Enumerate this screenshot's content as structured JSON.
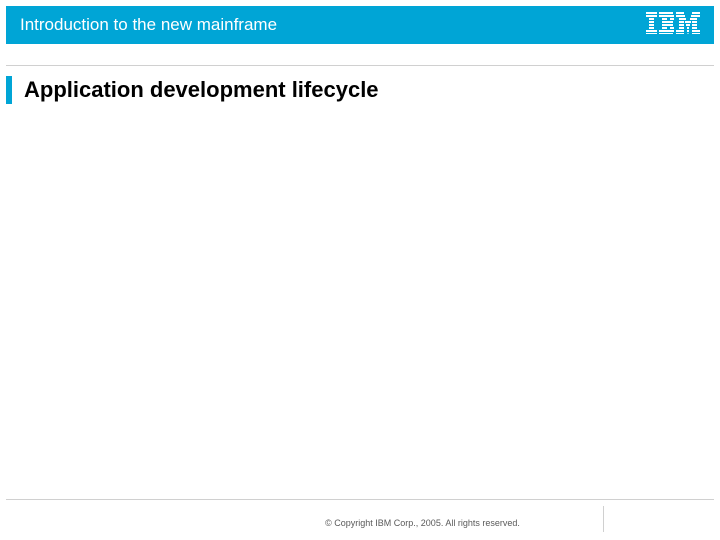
{
  "header": {
    "title": "Introduction to the new mainframe",
    "logo_name": "IBM"
  },
  "main": {
    "title": "Application development lifecycle"
  },
  "footer": {
    "copyright": "© Copyright IBM Corp., 2005. All rights reserved."
  },
  "colors": {
    "accent": "#00a5d6"
  }
}
